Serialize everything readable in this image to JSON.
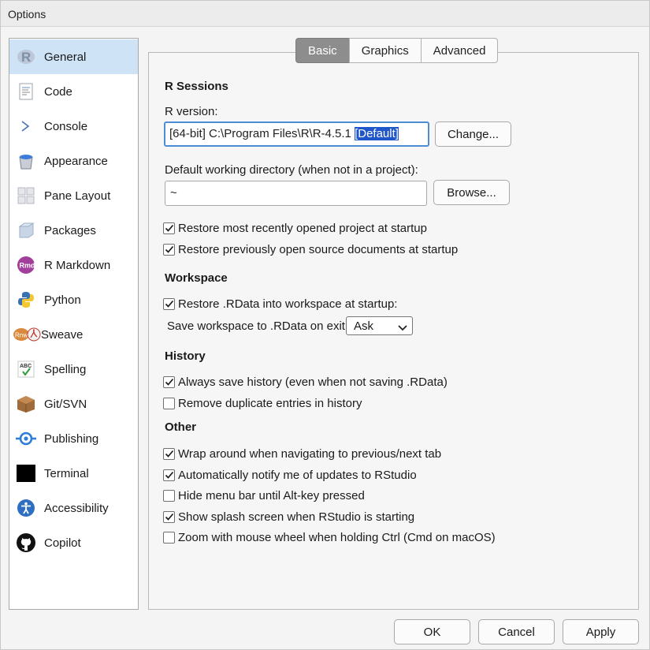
{
  "window": {
    "title": "Options"
  },
  "sidebar": {
    "items": [
      {
        "label": "General",
        "icon": "r-logo-icon"
      },
      {
        "label": "Code",
        "icon": "code-document-icon"
      },
      {
        "label": "Console",
        "icon": "console-prompt-icon"
      },
      {
        "label": "Appearance",
        "icon": "paint-bucket-icon"
      },
      {
        "label": "Pane Layout",
        "icon": "pane-grid-icon"
      },
      {
        "label": "Packages",
        "icon": "package-box-icon"
      },
      {
        "label": "R Markdown",
        "icon": "rmarkdown-icon",
        "badge": "Rmd"
      },
      {
        "label": "Python",
        "icon": "python-icon"
      },
      {
        "label": "Sweave",
        "icon": "sweave-icon",
        "badge": "Rnw"
      },
      {
        "label": "Spelling",
        "icon": "spelling-check-icon",
        "badge": "ABC"
      },
      {
        "label": "Git/SVN",
        "icon": "git-box-icon"
      },
      {
        "label": "Publishing",
        "icon": "publishing-icon"
      },
      {
        "label": "Terminal",
        "icon": "terminal-icon"
      },
      {
        "label": "Accessibility",
        "icon": "accessibility-icon"
      },
      {
        "label": "Copilot",
        "icon": "github-icon"
      }
    ],
    "active_index": 0
  },
  "tabs": [
    {
      "label": "Basic",
      "active": true
    },
    {
      "label": "Graphics",
      "active": false
    },
    {
      "label": "Advanced",
      "active": false
    }
  ],
  "r_sessions": {
    "title": "R Sessions",
    "r_version_label": "R version:",
    "r_version_value": "[64-bit] C:\\Program Files\\R\\R-4.5.1",
    "r_version_selected_suffix": "[Default]",
    "change_button": "Change...",
    "wd_label": "Default working directory (when not in a project):",
    "wd_value": "~",
    "browse_button": "Browse...",
    "restore_project": {
      "label": "Restore most recently opened project at startup",
      "checked": true
    },
    "restore_docs": {
      "label": "Restore previously open source documents at startup",
      "checked": true
    }
  },
  "workspace": {
    "title": "Workspace",
    "restore_rdata": {
      "label": "Restore .RData into workspace at startup:",
      "checked": true
    },
    "save_label": "Save workspace to .RData on exit:",
    "save_value": "Ask"
  },
  "history": {
    "title": "History",
    "always_save": {
      "label": "Always save history (even when not saving .RData)",
      "checked": true
    },
    "remove_dups": {
      "label": "Remove duplicate entries in history",
      "checked": false
    }
  },
  "other": {
    "title": "Other",
    "wrap_tabs": {
      "label": "Wrap around when navigating to previous/next tab",
      "checked": true
    },
    "notify_updates": {
      "label": "Automatically notify me of updates to RStudio",
      "checked": true
    },
    "hide_menu": {
      "label": "Hide menu bar until Alt-key pressed",
      "checked": false
    },
    "splash": {
      "label": "Show splash screen when RStudio is starting",
      "checked": true
    },
    "zoom_wheel": {
      "label": "Zoom with mouse wheel when holding Ctrl (Cmd on macOS)",
      "checked": false
    }
  },
  "footer": {
    "ok": "OK",
    "cancel": "Cancel",
    "apply": "Apply"
  }
}
